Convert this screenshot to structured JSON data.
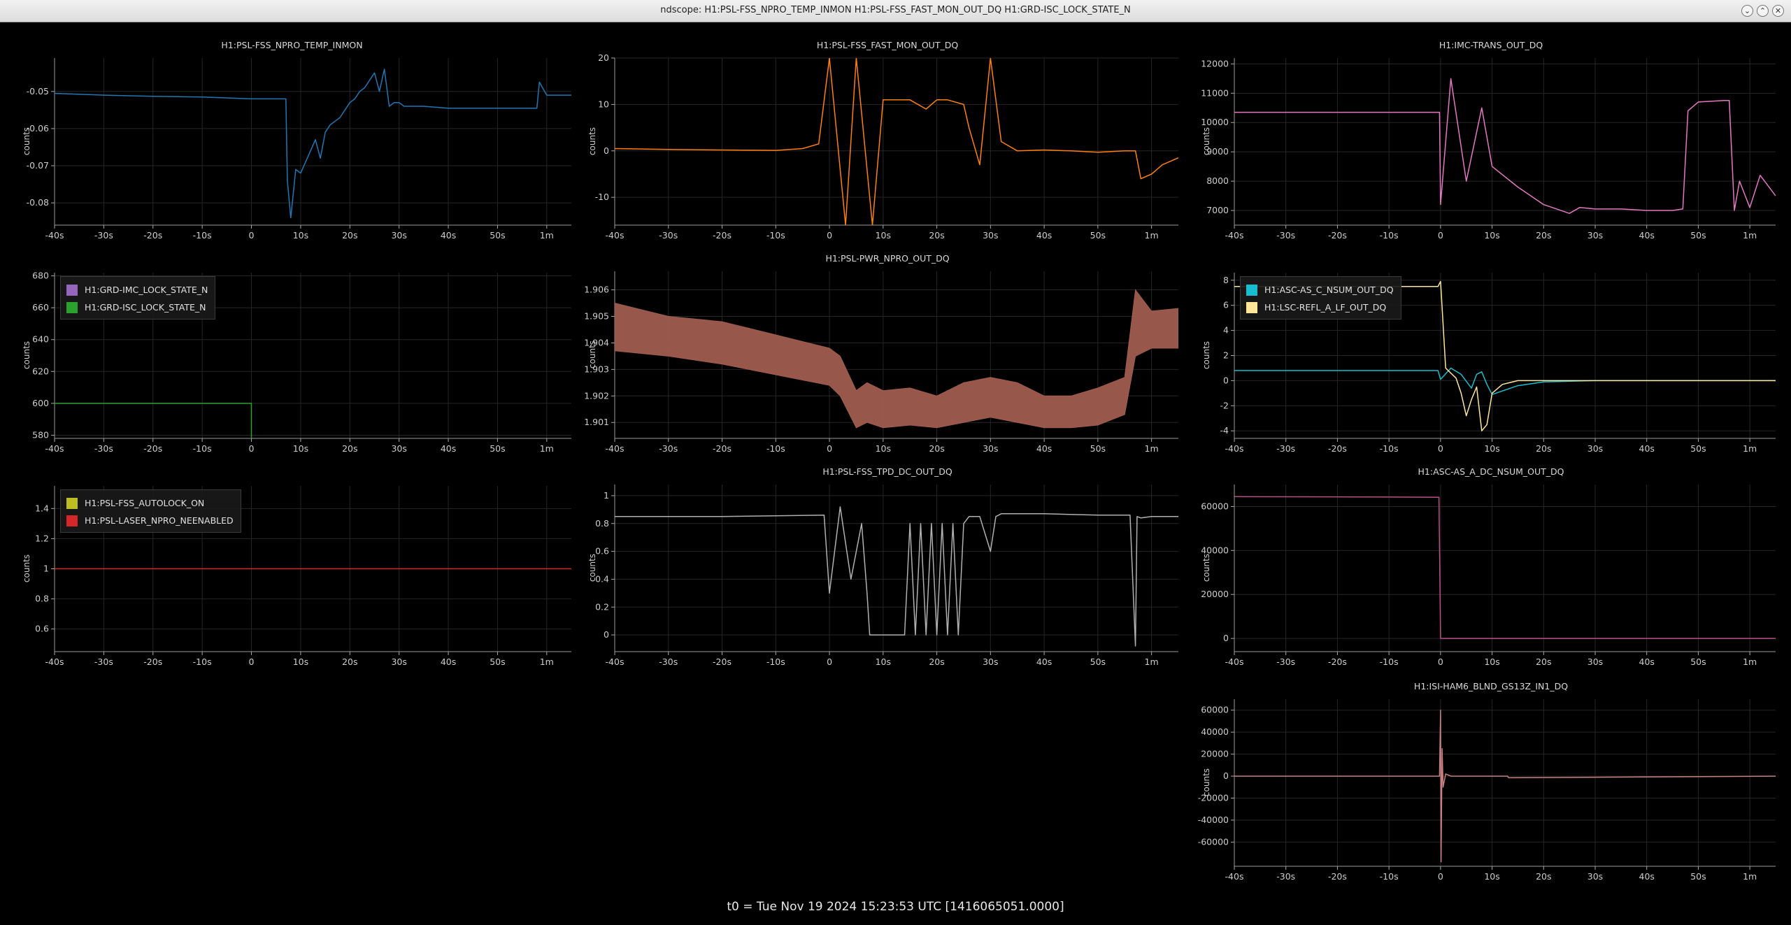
{
  "window": {
    "title": "ndscope: H1:PSL-FSS_NPRO_TEMP_INMON H1:PSL-FSS_FAST_MON_OUT_DQ H1:GRD-ISC_LOCK_STATE_N",
    "buttons": {
      "minimize": "⌄",
      "maximize": "⌃",
      "close": "✕"
    }
  },
  "status_text": "t0 = Tue Nov 19 2024 15:23:53 UTC [1416065051.0000]",
  "x_ticks": [
    "-40s",
    "-30s",
    "-20s",
    "-10s",
    "0",
    "10s",
    "20s",
    "30s",
    "40s",
    "50s",
    "1m"
  ],
  "ylabel": "counts",
  "icons": {
    "legend": "color-swatch"
  },
  "panels": [
    {
      "id": "p1",
      "title": "H1:PSL-FSS_NPRO_TEMP_INMON",
      "y_ticks": [
        "-0.05",
        "-0.06",
        "-0.07",
        "-0.08"
      ],
      "chart_data": {
        "type": "line",
        "xlim": [
          -40,
          65
        ],
        "ylim": [
          -0.086,
          -0.041
        ],
        "y_tick_values": [
          -0.05,
          -0.06,
          -0.07,
          -0.08
        ],
        "series": [
          {
            "color": "#1f77b4",
            "x": [
              -40,
              -30,
              -20,
              -10,
              0,
              5,
              7,
              7.3,
              8,
              9,
              10,
              12,
              13,
              14,
              15,
              16,
              17,
              18,
              19,
              20,
              21,
              22,
              23,
              24,
              25,
              26,
              27,
              28,
              29,
              30,
              31,
              35,
              40,
              50,
              58,
              58.5,
              60,
              65
            ],
            "y": [
              -0.0505,
              -0.051,
              -0.0513,
              -0.0515,
              -0.052,
              -0.052,
              -0.052,
              -0.074,
              -0.084,
              -0.071,
              -0.072,
              -0.066,
              -0.063,
              -0.068,
              -0.061,
              -0.059,
              -0.058,
              -0.057,
              -0.055,
              -0.053,
              -0.052,
              -0.05,
              -0.049,
              -0.047,
              -0.045,
              -0.05,
              -0.044,
              -0.054,
              -0.053,
              -0.053,
              -0.054,
              -0.054,
              -0.0545,
              -0.0545,
              -0.0545,
              -0.0475,
              -0.051,
              -0.051
            ]
          }
        ]
      }
    },
    {
      "id": "p2",
      "title": "H1:PSL-FSS_FAST_MON_OUT_DQ",
      "y_ticks": [
        "20",
        "10",
        "0",
        "-10"
      ],
      "chart_data": {
        "type": "line",
        "xlim": [
          -40,
          65
        ],
        "ylim": [
          -16,
          20
        ],
        "y_tick_values": [
          20,
          10,
          0,
          -10
        ],
        "series": [
          {
            "color": "#ff7f0e",
            "x": [
              -40,
              -30,
              -20,
              -10,
              -5,
              -2,
              0,
              3,
              5,
              8,
              10,
              15,
              18,
              20,
              22,
              25,
              26,
              28,
              30,
              32,
              35,
              40,
              45,
              50,
              55,
              57,
              58,
              60,
              62,
              65
            ],
            "y": [
              0.5,
              0.3,
              0.2,
              0.1,
              0.5,
              1.5,
              20,
              -16,
              20,
              -16,
              11,
              11,
              9,
              11,
              11,
              10,
              5,
              -3,
              20,
              2,
              0,
              0.2,
              0,
              -0.3,
              0,
              0,
              -6,
              -5,
              -3,
              -1.5
            ]
          }
        ]
      }
    },
    {
      "id": "p3",
      "title": "H1:IMC-TRANS_OUT_DQ",
      "y_ticks": [
        "12000",
        "11000",
        "10000",
        "9000",
        "8000",
        "7000"
      ],
      "chart_data": {
        "type": "line",
        "xlim": [
          -40,
          65
        ],
        "ylim": [
          6500,
          12200
        ],
        "y_tick_values": [
          12000,
          11000,
          10000,
          9000,
          8000,
          7000
        ],
        "series": [
          {
            "color": "#e377c2",
            "x": [
              -40,
              -10,
              -0.2,
              0,
              2,
              5,
              8,
              10,
              15,
              20,
              25,
              27,
              30,
              35,
              40,
              45,
              47,
              48,
              50,
              55,
              56,
              57,
              58,
              60,
              62,
              65
            ],
            "y": [
              10350,
              10350,
              10350,
              7200,
              11500,
              8000,
              10500,
              8500,
              7800,
              7200,
              6900,
              7100,
              7050,
              7050,
              7000,
              7000,
              7050,
              10400,
              10700,
              10750,
              10750,
              7000,
              8000,
              7100,
              8200,
              7500
            ]
          }
        ]
      }
    },
    {
      "id": "p4",
      "title": "",
      "y_ticks": [
        "680",
        "660",
        "640",
        "620",
        "600",
        "580"
      ],
      "legend": [
        {
          "label": "H1:GRD-IMC_LOCK_STATE_N",
          "color": "#9467bd"
        },
        {
          "label": "H1:GRD-ISC_LOCK_STATE_N",
          "color": "#2ca02c"
        }
      ],
      "chart_data": {
        "type": "line",
        "xlim": [
          -40,
          65
        ],
        "ylim": [
          578,
          682
        ],
        "y_tick_values": [
          680,
          660,
          640,
          620,
          600,
          580
        ],
        "series": [
          {
            "name": "H1:GRD-ISC_LOCK_STATE_N",
            "color": "#2ca02c",
            "x": [
              -40,
              0,
              0
            ],
            "y": [
              600,
              600,
              578
            ]
          }
        ]
      }
    },
    {
      "id": "p5",
      "title": "H1:PSL-PWR_NPRO_OUT_DQ",
      "y_ticks": [
        "1.906",
        "1.905",
        "1.904",
        "1.903",
        "1.902",
        "1.901"
      ],
      "chart_data": {
        "type": "band",
        "xlim": [
          -40,
          65
        ],
        "ylim": [
          1.9004,
          1.9067
        ],
        "y_tick_values": [
          1.906,
          1.905,
          1.904,
          1.903,
          1.902,
          1.901
        ],
        "series": [
          {
            "color": "#a05c4f",
            "x": [
              -40,
              -30,
              -20,
              -10,
              0,
              2,
              5,
              7,
              10,
              15,
              20,
              25,
              30,
              35,
              40,
              45,
              50,
              55,
              57,
              60,
              65
            ],
            "upper": [
              1.9055,
              1.905,
              1.9048,
              1.9043,
              1.9038,
              1.9035,
              1.9022,
              1.9025,
              1.9022,
              1.9023,
              1.902,
              1.9025,
              1.9027,
              1.9025,
              1.902,
              1.902,
              1.9023,
              1.9027,
              1.906,
              1.9052,
              1.9053
            ],
            "lower": [
              1.9037,
              1.9035,
              1.9032,
              1.9028,
              1.9024,
              1.902,
              1.9008,
              1.901,
              1.9008,
              1.9009,
              1.9008,
              1.901,
              1.9012,
              1.901,
              1.9008,
              1.9008,
              1.9009,
              1.9013,
              1.9035,
              1.9038,
              1.9038
            ]
          }
        ]
      }
    },
    {
      "id": "p6",
      "title": "",
      "y_ticks": [
        "8",
        "6",
        "4",
        "2",
        "0",
        "-2",
        "-4"
      ],
      "legend": [
        {
          "label": "H1:ASC-AS_C_NSUM_OUT_DQ",
          "color": "#17becf"
        },
        {
          "label": "H1:LSC-REFL_A_LF_OUT_DQ",
          "color": "#ffe699"
        }
      ],
      "chart_data": {
        "type": "line",
        "xlim": [
          -40,
          65
        ],
        "ylim": [
          -4.6,
          8.6
        ],
        "y_tick_values": [
          8,
          6,
          4,
          2,
          0,
          -2,
          -4
        ],
        "series": [
          {
            "name": "H1:ASC-AS_C_NSUM_OUT_DQ",
            "color": "#17becf",
            "x": [
              -40,
              -10,
              -0.5,
              0,
              2,
              4,
              6,
              7,
              8,
              9,
              10,
              15,
              20,
              30,
              65
            ],
            "y": [
              0.8,
              0.8,
              0.8,
              0.1,
              1,
              0.5,
              -0.6,
              0.5,
              0.7,
              -0.3,
              -1.1,
              -0.4,
              -0.1,
              0,
              0
            ]
          },
          {
            "name": "H1:LSC-REFL_A_LF_OUT_DQ",
            "color": "#ffe699",
            "x": [
              -40,
              -5,
              -0.5,
              0,
              1,
              3,
              4,
              5,
              6,
              7,
              8,
              9,
              10,
              12,
              15,
              20,
              30,
              65
            ],
            "y": [
              7.5,
              7.5,
              7.5,
              7.9,
              1,
              0.2,
              -1,
              -2.8,
              -1.5,
              -0.5,
              -4,
              -3.5,
              -1,
              -0.3,
              0,
              0,
              0,
              0
            ]
          }
        ]
      }
    },
    {
      "id": "p7",
      "title": "",
      "y_ticks": [
        "1.4",
        "1.2",
        "1",
        "0.8",
        "0.6"
      ],
      "legend": [
        {
          "label": "H1:PSL-FSS_AUTOLOCK_ON",
          "color": "#bcbd22"
        },
        {
          "label": "H1:PSL-LASER_NPRO_NEENABLED",
          "color": "#d62728"
        }
      ],
      "chart_data": {
        "type": "line",
        "xlim": [
          -40,
          65
        ],
        "ylim": [
          0.45,
          1.55
        ],
        "y_tick_values": [
          1.4,
          1.2,
          1,
          0.8,
          0.6
        ],
        "series": [
          {
            "name": "H1:PSL-LASER_NPRO_NEENABLED",
            "color": "#d62728",
            "x": [
              -40,
              65
            ],
            "y": [
              1,
              1
            ]
          }
        ]
      }
    },
    {
      "id": "p8",
      "title": "H1:PSL-FSS_TPD_DC_OUT_DQ",
      "y_ticks": [
        "1",
        "0.8",
        "0.6",
        "0.4",
        "0.2",
        "0"
      ],
      "chart_data": {
        "type": "line",
        "xlim": [
          -40,
          65
        ],
        "ylim": [
          -0.12,
          1.08
        ],
        "y_tick_values": [
          1,
          0.8,
          0.6,
          0.4,
          0.2,
          0
        ],
        "series": [
          {
            "color": "#b0b0b0",
            "x": [
              -40,
              -20,
              -1,
              0,
              2,
              4,
              6,
              7,
              7.5,
              8,
              10,
              14,
              15,
              16,
              17,
              18,
              19,
              20,
              21,
              22,
              23,
              24,
              25,
              26,
              28,
              30,
              31,
              32,
              35,
              40,
              50,
              56,
              57,
              57.3,
              58,
              60,
              65
            ],
            "y": [
              0.85,
              0.85,
              0.86,
              0.3,
              0.92,
              0.4,
              0.8,
              0.3,
              0,
              0,
              0,
              0,
              0.8,
              0,
              0.8,
              0,
              0.8,
              0,
              0.8,
              0,
              0.8,
              0,
              0.8,
              0.85,
              0.85,
              0.6,
              0.85,
              0.87,
              0.87,
              0.87,
              0.86,
              0.86,
              -0.08,
              0.85,
              0.84,
              0.85,
              0.85
            ]
          }
        ]
      }
    },
    {
      "id": "p9",
      "title": "H1:ASC-AS_A_DC_NSUM_OUT_DQ",
      "y_ticks": [
        "60000",
        "40000",
        "20000",
        "0"
      ],
      "chart_data": {
        "type": "line",
        "xlim": [
          -40,
          65
        ],
        "ylim": [
          -6000,
          70000
        ],
        "y_tick_values": [
          60000,
          40000,
          20000,
          0
        ],
        "series": [
          {
            "color": "#b74e86",
            "x": [
              -40,
              -10,
              -0.3,
              0,
              0.2,
              65
            ],
            "y": [
              64500,
              64300,
              64200,
              0,
              0,
              0
            ]
          }
        ]
      }
    },
    {
      "id": "p10",
      "title": "H1:ISI-HAM6_BLND_GS13Z_IN1_DQ",
      "y_ticks": [
        "60000",
        "40000",
        "20000",
        "0",
        "-20000",
        "-40000",
        "-60000"
      ],
      "chart_data": {
        "type": "line",
        "xlim": [
          -40,
          65
        ],
        "ylim": [
          -82000,
          70000
        ],
        "y_tick_values": [
          60000,
          40000,
          20000,
          0,
          -20000,
          -40000,
          -60000
        ],
        "series": [
          {
            "color": "#c88080",
            "x": [
              -40,
              -1,
              -0.2,
              0,
              0.1,
              0.3,
              0.5,
              1,
              2,
              13,
              13.2,
              65
            ],
            "y": [
              0,
              0,
              0,
              60000,
              -78000,
              25000,
              -10000,
              2000,
              0,
              0,
              -1500,
              0
            ]
          }
        ]
      }
    }
  ]
}
